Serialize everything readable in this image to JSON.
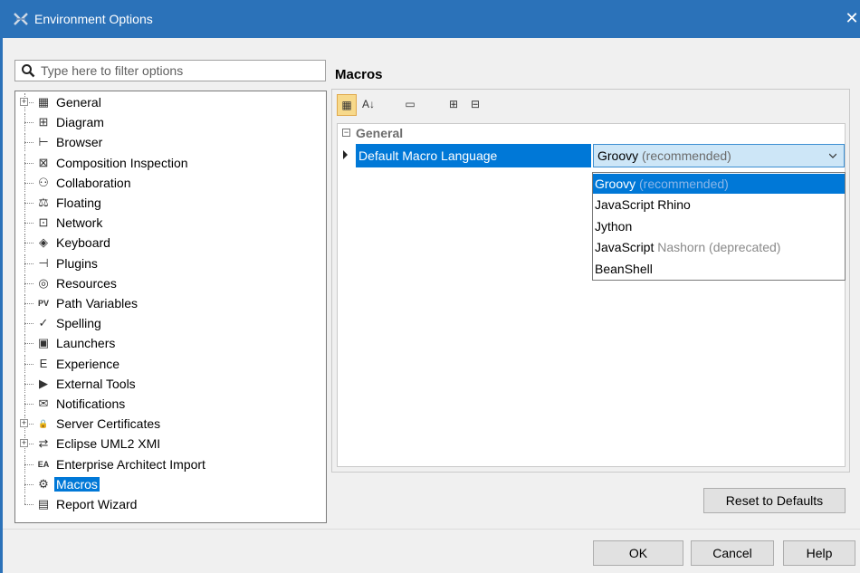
{
  "window": {
    "title": "Environment Options",
    "close_glyph": "✕"
  },
  "filter": {
    "placeholder": "Type here to filter options",
    "value": ""
  },
  "tree": {
    "items": [
      {
        "label": "General",
        "icon": "general-icon",
        "glyph": "▦",
        "expandable": true,
        "selected": false
      },
      {
        "label": "Diagram",
        "icon": "diagram-icon",
        "glyph": "⊞",
        "expandable": false,
        "selected": false
      },
      {
        "label": "Browser",
        "icon": "browser-icon",
        "glyph": "⊢",
        "expandable": false,
        "selected": false
      },
      {
        "label": "Composition Inspection",
        "icon": "composition-icon",
        "glyph": "⊠",
        "expandable": false,
        "selected": false
      },
      {
        "label": "Collaboration",
        "icon": "collaboration-icon",
        "glyph": "⚇",
        "expandable": false,
        "selected": false
      },
      {
        "label": "Floating",
        "icon": "floating-icon",
        "glyph": "⚖",
        "expandable": false,
        "selected": false
      },
      {
        "label": "Network",
        "icon": "network-icon",
        "glyph": "⊡",
        "expandable": false,
        "selected": false
      },
      {
        "label": "Keyboard",
        "icon": "keyboard-icon",
        "glyph": "◈",
        "expandable": false,
        "selected": false
      },
      {
        "label": "Plugins",
        "icon": "plugins-icon",
        "glyph": "⊣",
        "expandable": false,
        "selected": false
      },
      {
        "label": "Resources",
        "icon": "resources-icon",
        "glyph": "◎",
        "expandable": false,
        "selected": false
      },
      {
        "label": "Path Variables",
        "icon": "path-variables-icon",
        "glyph": "PV",
        "expandable": false,
        "selected": false
      },
      {
        "label": "Spelling",
        "icon": "spelling-icon",
        "glyph": "✓",
        "expandable": false,
        "selected": false
      },
      {
        "label": "Launchers",
        "icon": "launchers-icon",
        "glyph": "▣",
        "expandable": false,
        "selected": false
      },
      {
        "label": "Experience",
        "icon": "experience-icon",
        "glyph": "E",
        "expandable": false,
        "selected": false
      },
      {
        "label": "External Tools",
        "icon": "external-tools-icon",
        "glyph": "▶",
        "expandable": false,
        "selected": false
      },
      {
        "label": "Notifications",
        "icon": "notifications-icon",
        "glyph": "✉",
        "expandable": false,
        "selected": false
      },
      {
        "label": "Server Certificates",
        "icon": "lock-icon",
        "glyph": "🔒",
        "expandable": true,
        "selected": false
      },
      {
        "label": "Eclipse UML2 XMI",
        "icon": "exchange-icon",
        "glyph": "⇄",
        "expandable": true,
        "selected": false
      },
      {
        "label": "Enterprise Architect Import",
        "icon": "ea-import-icon",
        "glyph": "EA",
        "expandable": false,
        "selected": false
      },
      {
        "label": "Macros",
        "icon": "gear-icon",
        "glyph": "⚙",
        "expandable": false,
        "selected": true
      },
      {
        "label": "Report Wizard",
        "icon": "report-icon",
        "glyph": "▤",
        "expandable": false,
        "selected": false
      }
    ]
  },
  "panel": {
    "title": "Macros",
    "toolbar": [
      {
        "name": "categorized-view-button",
        "glyph": "▦",
        "active": true
      },
      {
        "name": "sort-alphabetical-button",
        "glyph": "A↓",
        "active": false
      },
      {
        "name": "description-toggle-button",
        "glyph": "▭",
        "active": false
      },
      {
        "name": "expand-all-button",
        "glyph": "⊞",
        "active": false
      },
      {
        "name": "collapse-all-button",
        "glyph": "⊟",
        "active": false
      }
    ],
    "group": {
      "label": "General",
      "collapse_glyph": "−"
    },
    "property": {
      "name": "Default Macro Language",
      "value_main": "Groovy",
      "value_note": " (recommended)"
    },
    "dropdown_options": [
      {
        "main": "Groovy",
        "note": " (recommended)",
        "selected": true
      },
      {
        "main": "JavaScript Rhino",
        "note": "",
        "selected": false
      },
      {
        "main": "Jython",
        "note": "",
        "selected": false
      },
      {
        "main": "JavaScript",
        "note": " Nashorn (deprecated)",
        "selected": false
      },
      {
        "main": "BeanShell",
        "note": "",
        "selected": false
      }
    ]
  },
  "buttons": {
    "reset": "Reset to Defaults",
    "ok": "OK",
    "cancel": "Cancel",
    "help": "Help"
  },
  "colors": {
    "titlebar": "#2b72b9",
    "selection": "#0078d7",
    "combo_bg": "#cde6f7"
  }
}
